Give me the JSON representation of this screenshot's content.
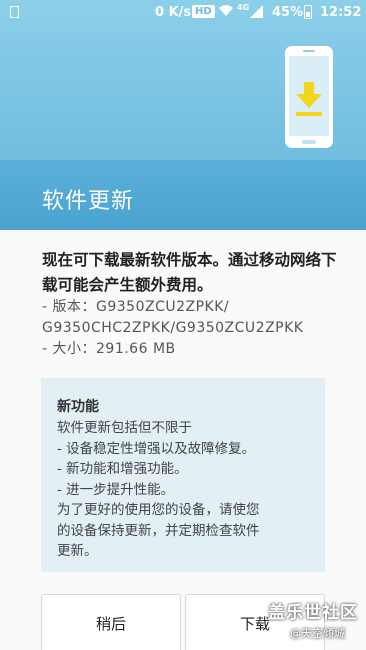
{
  "status_bar": {
    "network_speed": "0 K/s",
    "hd_badge": "HD",
    "network_type": "4G",
    "battery_percent": "45%",
    "time": "12:52"
  },
  "header": {
    "title": "软件更新",
    "illustration_icon": "phone-download-icon"
  },
  "body": {
    "description": "现在可下载最新软件版本。通过移动网络下载可能会产生额外费用。",
    "version_label": "- 版本：G9350ZCU2ZPKK/",
    "version_cont": "G9350CHC2ZPKK/G9350ZCU2ZPKK",
    "size_label": "- 大小：291.66 MB"
  },
  "features": {
    "title": "新功能",
    "lines": [
      "软件更新包括但不限于",
      "- 设备稳定性增强以及故障修复。",
      "- 新功能和增强功能。",
      "- 进一步提升性能。",
      "为了更好的使用您的设备，请使您",
      "的设备保持更新，并定期检查软件",
      "更新。"
    ]
  },
  "buttons": {
    "later": "稍后",
    "download": "下载"
  },
  "watermark": {
    "main": "盖乐世社区",
    "sub": "@天空倾城"
  },
  "colors": {
    "header_top": "#8ccfe9",
    "header_band": "#4aa3d0",
    "feature_bg": "#e2eff4",
    "download_arrow": "#f2d51c"
  }
}
